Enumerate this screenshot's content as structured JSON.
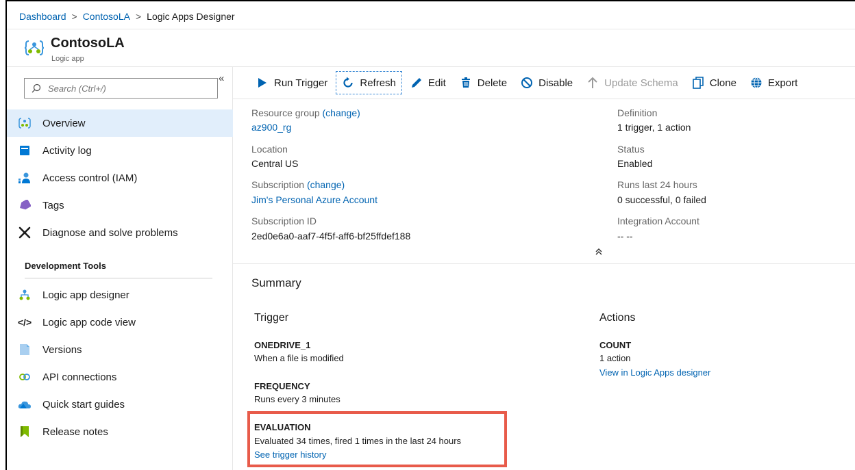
{
  "breadcrumb": {
    "items": [
      "Dashboard",
      "ContosoLA",
      "Logic Apps Designer"
    ],
    "separator": ">"
  },
  "resource": {
    "title": "ContosoLA",
    "subtitle": "Logic app",
    "icon": "logic-app-icon"
  },
  "sidebar": {
    "search_placeholder": "Search (Ctrl+/)",
    "collapse_glyph": "«",
    "items": [
      {
        "label": "Overview",
        "icon": "overview-icon"
      },
      {
        "label": "Activity log",
        "icon": "activity-log-icon"
      },
      {
        "label": "Access control (IAM)",
        "icon": "iam-icon"
      },
      {
        "label": "Tags",
        "icon": "tag-icon"
      },
      {
        "label": "Diagnose and solve problems",
        "icon": "wrench-icon"
      }
    ],
    "section_title": "Development Tools",
    "dev_items": [
      {
        "label": "Logic app designer",
        "icon": "designer-icon"
      },
      {
        "label": "Logic app code view",
        "icon": "code-icon"
      },
      {
        "label": "Versions",
        "icon": "versions-icon"
      },
      {
        "label": "API connections",
        "icon": "api-connections-icon"
      },
      {
        "label": "Quick start guides",
        "icon": "cloud-icon"
      },
      {
        "label": "Release notes",
        "icon": "bookmark-icon"
      }
    ]
  },
  "toolbar": {
    "run_trigger": "Run Trigger",
    "refresh": "Refresh",
    "edit": "Edit",
    "delete": "Delete",
    "disable": "Disable",
    "update_schema": "Update Schema",
    "clone": "Clone",
    "export": "Export"
  },
  "essentials": {
    "resource_group_label": "Resource group",
    "change": "(change)",
    "resource_group_value": "az900_rg",
    "location_label": "Location",
    "location_value": "Central US",
    "subscription_label": "Subscription",
    "subscription_value": "Jim's Personal Azure Account",
    "subscription_id_label": "Subscription ID",
    "subscription_id_value": "2ed0e6a0-aaf7-4f5f-aff6-bf25ffdef188",
    "definition_label": "Definition",
    "definition_value": "1 trigger, 1 action",
    "status_label": "Status",
    "status_value": "Enabled",
    "runs_label": "Runs last 24 hours",
    "runs_value": "0 successful, 0 failed",
    "integration_label": "Integration Account",
    "integration_value": "-- --",
    "collapse_glyph": "«"
  },
  "summary": {
    "title": "Summary",
    "trigger_heading": "Trigger",
    "actions_heading": "Actions",
    "trigger_name_label": "ONEDRIVE_1",
    "trigger_name_value": "When a file is modified",
    "frequency_label": "FREQUENCY",
    "frequency_value": "Runs every 3 minutes",
    "evaluation_label": "EVALUATION",
    "evaluation_value": "Evaluated 34 times, fired 1 times in the last 24 hours",
    "evaluation_link": "See trigger history",
    "count_label": "COUNT",
    "count_value": "1 action",
    "count_link": "View in Logic Apps designer"
  },
  "colors": {
    "link": "#0063b1",
    "active_nav": "#e1eefb",
    "highlight": "#e85b4a"
  }
}
